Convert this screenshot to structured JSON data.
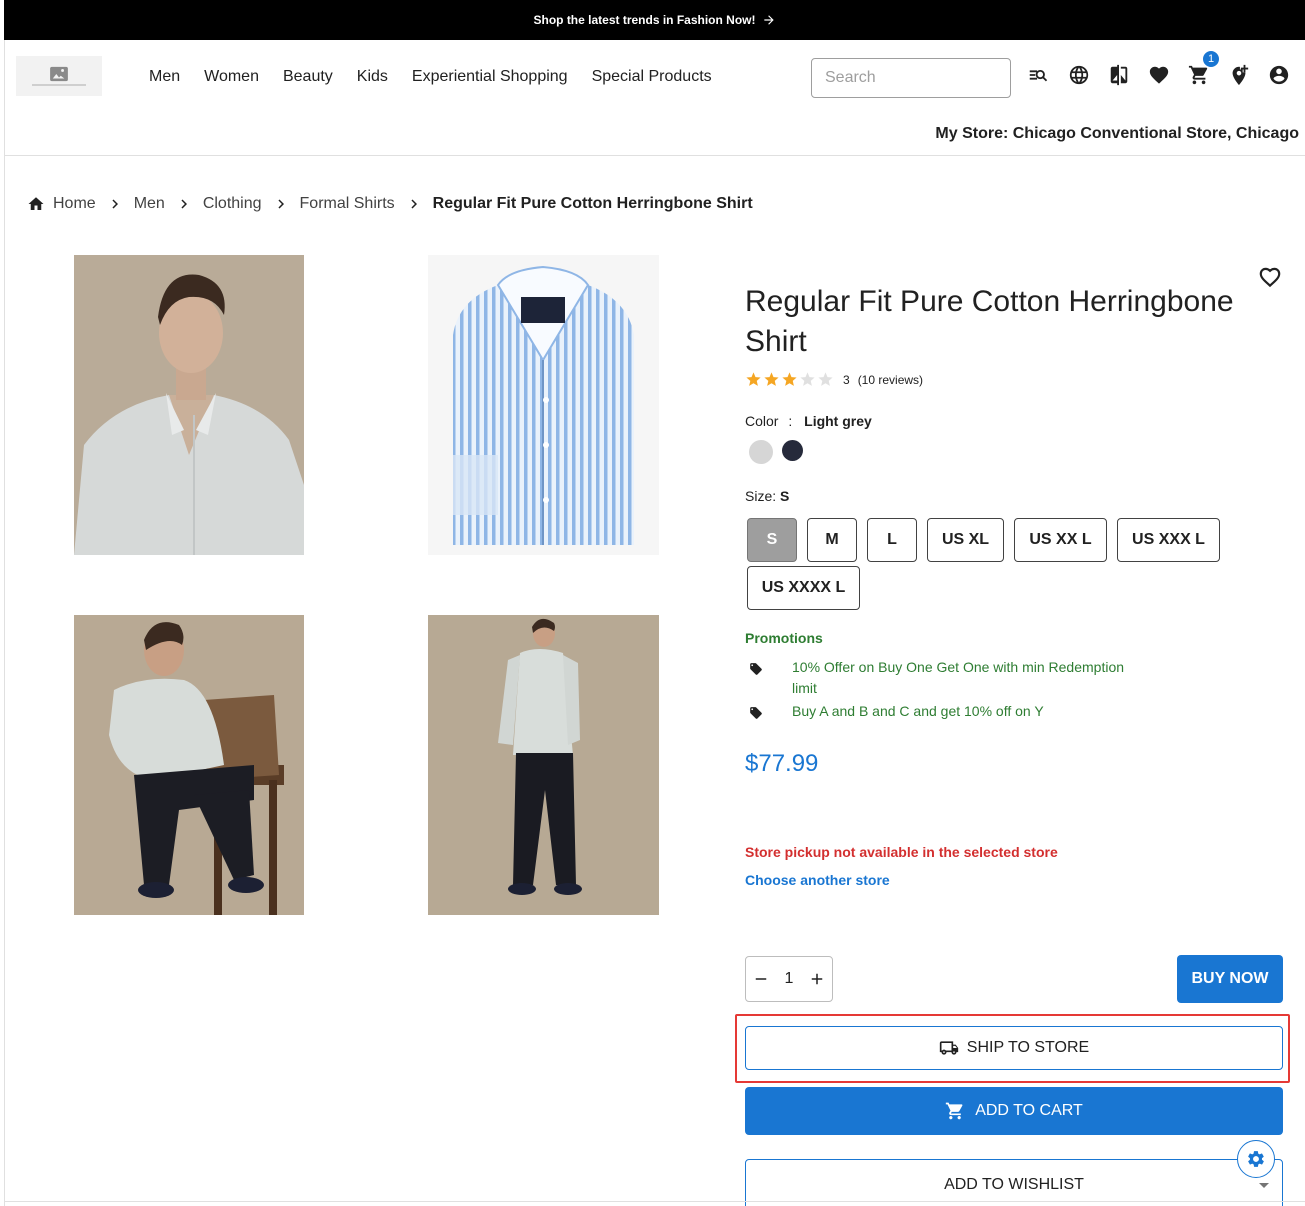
{
  "banner": {
    "text": "Shop the latest trends in Fashion Now!"
  },
  "nav": {
    "items": [
      "Men",
      "Women",
      "Beauty",
      "Kids",
      "Experiential Shopping",
      "Special Products"
    ]
  },
  "search": {
    "placeholder": "Search"
  },
  "cart": {
    "count": "1"
  },
  "my_store": "My Store: Chicago Conventional Store, Chicago",
  "breadcrumb": {
    "items": [
      "Home",
      "Men",
      "Clothing",
      "Formal Shirts"
    ],
    "current": "Regular Fit Pure Cotton Herringbone Shirt"
  },
  "product": {
    "title": "Regular Fit Pure Cotton Herringbone Shirt",
    "rating": {
      "stars": 3,
      "max": 5,
      "value": "3",
      "reviews": "(10 reviews)"
    },
    "color": {
      "label": "Color",
      "separator": ":",
      "selected": "Light grey",
      "swatches": [
        "#d6d6d6",
        "#262a3b"
      ]
    },
    "size": {
      "label": "Size:",
      "selected": "S",
      "options": [
        "S",
        "M",
        "L",
        "US XL",
        "US XX L",
        "US XXX L",
        "US XXXX L"
      ]
    },
    "promotions": {
      "title": "Promotions",
      "items": [
        "10% Offer on Buy One Get One with min Redemption limit",
        "Buy A and B and C and get 10% off on Y"
      ]
    },
    "price": "$77.99",
    "pickup_message": "Store pickup not available in the selected store",
    "choose_store": "Choose another store",
    "quantity": "1"
  },
  "actions": {
    "buy_now": "BUY NOW",
    "ship_to_store": "SHIP TO STORE",
    "add_to_cart": "ADD TO CART",
    "add_to_wishlist": "ADD TO WISHLIST"
  },
  "colors": {
    "accent": "#1976d2",
    "promo": "#2e7d32",
    "error": "#d32f2f",
    "highlight": "#e53935",
    "star": "#f5a623"
  },
  "icons": [
    "arrow-right-icon",
    "image-placeholder-icon",
    "search-list-icon",
    "globe-icon",
    "compare-icon",
    "heart-icon",
    "cart-icon",
    "location-add-icon",
    "account-icon",
    "home-icon",
    "chevron-right-icon",
    "tag-icon",
    "minus-icon",
    "plus-icon",
    "truck-icon",
    "caret-down-icon",
    "gear-icon"
  ]
}
